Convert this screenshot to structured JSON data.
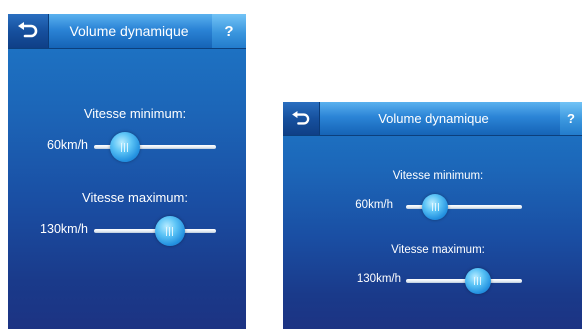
{
  "large_screen": {
    "title": "Volume dynamique",
    "back_icon": "back-arrow-icon",
    "help_label": "?",
    "min_label": "Vitesse minimum:",
    "min_value": "60km/h",
    "min_level": 0.25,
    "max_label": "Vitesse maximum:",
    "max_value": "130km/h",
    "max_level": 0.62
  },
  "small_screen": {
    "title": "Volume dynamique",
    "back_icon": "back-arrow-icon",
    "help_label": "?",
    "min_label": "Vitesse minimum:",
    "min_value": "60km/h",
    "min_level": 0.25,
    "max_label": "Vitesse maximum:",
    "max_value": "130km/h",
    "max_level": 0.62
  },
  "colors": {
    "background_top": "#1e78c8",
    "background_bottom": "#1c3383",
    "header": "#2b84d6",
    "help_button": "#3a96de",
    "thumb": "#2391e0",
    "text": "#ffffff"
  }
}
